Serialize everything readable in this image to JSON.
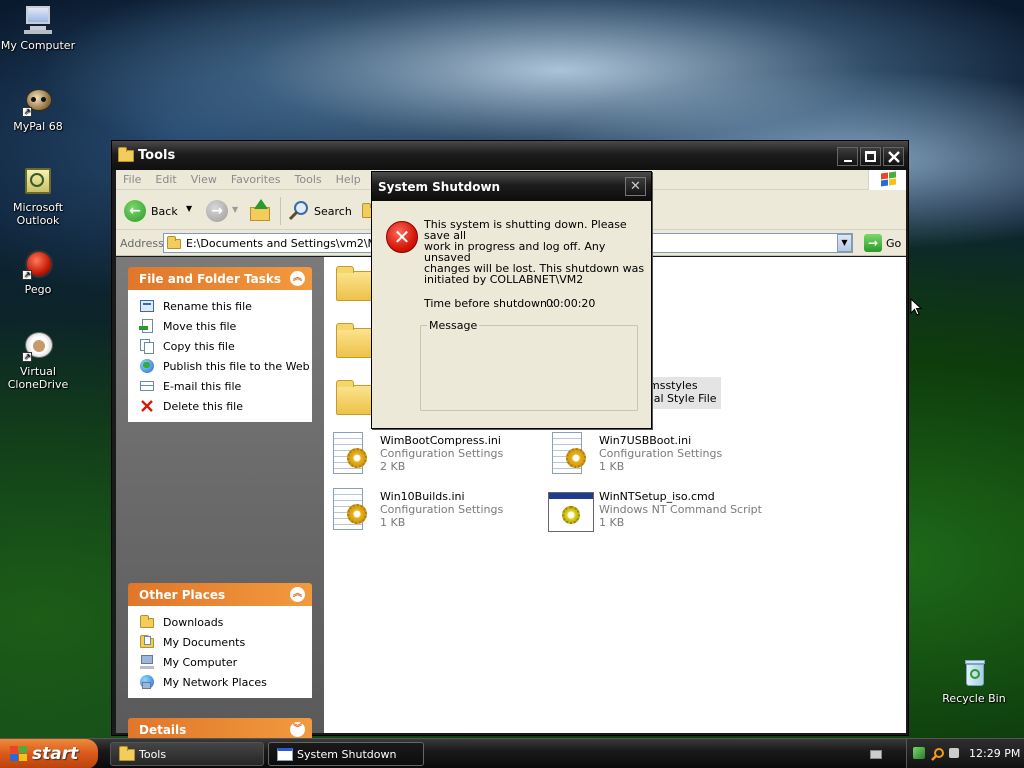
{
  "desktop": {
    "icons": [
      {
        "label": "My Computer"
      },
      {
        "label": "MyPal 68"
      },
      {
        "label": "Microsoft Outlook"
      },
      {
        "label": "Pego"
      },
      {
        "label": "Virtual CloneDrive"
      },
      {
        "label": "Recycle Bin"
      }
    ]
  },
  "explorer": {
    "title": "Tools",
    "menu": [
      "File",
      "Edit",
      "View",
      "Favorites",
      "Tools",
      "Help"
    ],
    "toolbar": {
      "back_label": "Back",
      "search_label": "Search"
    },
    "address": {
      "label": "Address",
      "value": "E:\\Documents and Settings\\vm2\\My Do",
      "go_label": "Go"
    },
    "file_tasks": {
      "title": "File and Folder Tasks",
      "items": [
        "Rename this file",
        "Move this file",
        "Copy this file",
        "Publish this file to the Web",
        "E-mail this file",
        "Delete this file"
      ]
    },
    "other_places": {
      "title": "Other Places",
      "items": [
        "Downloads",
        "My Documents",
        "My Computer",
        "My Network Places"
      ]
    },
    "details": {
      "title": "Details"
    },
    "files": [
      {
        "name": "msstyles",
        "type": "sual Style File",
        "size": ""
      },
      {
        "name": "WimBootCompress.ini",
        "type": "Configuration Settings",
        "size": "2 KB"
      },
      {
        "name": "Win7USBBoot.ini",
        "type": "Configuration Settings",
        "size": "1 KB"
      },
      {
        "name": "Win10Builds.ini",
        "type": "Configuration Settings",
        "size": "1 KB"
      },
      {
        "name": "WinNTSetup_iso.cmd",
        "type": "Windows NT Command Script",
        "size": "1 KB"
      }
    ]
  },
  "dialog": {
    "title": "System Shutdown",
    "close_glyph": "✕",
    "message_lines": [
      "This system is shutting down. Please save all",
      "work in progress and log off. Any unsaved",
      "changes will be lost. This shutdown was",
      "initiated by COLLABNET\\VM2"
    ],
    "time_label": "Time before shutdown :",
    "time_value": "00:00:20",
    "message_group_label": "Message",
    "message_text": ""
  },
  "taskbar": {
    "start_label": "start",
    "buttons": [
      {
        "label": "Tools"
      },
      {
        "label": "System Shutdown"
      }
    ],
    "clock": "12:29 PM"
  },
  "colors": {
    "panel_header": "#e0762a",
    "start_button": "#d9581a",
    "error_red": "#d41a0a"
  }
}
